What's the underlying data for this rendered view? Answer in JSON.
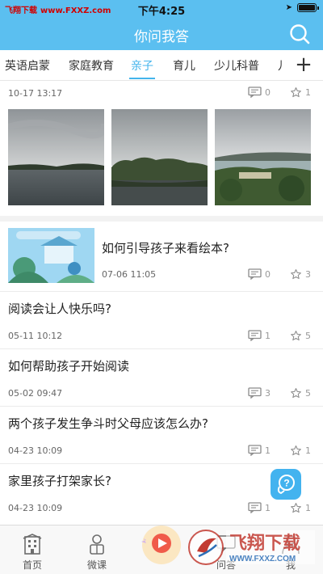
{
  "status_bar": {
    "watermark": "飞翔下载",
    "watermark_url": "www.FXXZ.com",
    "time": "下午4:25"
  },
  "nav": {
    "title": "你问我答",
    "search_icon": "search-icon"
  },
  "tabs": {
    "items": [
      "英语启蒙",
      "家庭教育",
      "亲子",
      "育儿",
      "少儿科普",
      "儿"
    ],
    "active_index": 2,
    "add_icon": "plus-icon"
  },
  "feed": {
    "photo_post": {
      "time": "10-17 13:17",
      "comments": "0",
      "likes": "1"
    },
    "thumb_post": {
      "title": "如何引导孩子来看绘本?",
      "time": "07-06 11:05",
      "comments": "0",
      "likes": "3"
    },
    "questions": [
      {
        "title": "阅读会让人快乐吗?",
        "time": "05-11 10:12",
        "comments": "1",
        "likes": "5"
      },
      {
        "title": "如何帮助孩子开始阅读",
        "time": "05-02 09:47",
        "comments": "3",
        "likes": "5"
      },
      {
        "title": "两个孩子发生争斗时父母应该怎么办?",
        "time": "04-23 10:09",
        "comments": "1",
        "likes": "1"
      },
      {
        "title": "家里孩子打架家长?",
        "time": "04-23 10:09",
        "comments": "1",
        "likes": "1"
      }
    ]
  },
  "fab": {
    "icon": "help-question-icon"
  },
  "tabbar": {
    "items": [
      {
        "label": "首页",
        "icon": "building-icon"
      },
      {
        "label": "微课",
        "icon": "person-icon"
      },
      {
        "label": "",
        "icon": "play-icon"
      },
      {
        "label": "问答",
        "icon": "chat-icon"
      },
      {
        "label": "我",
        "icon": "user-icon"
      }
    ]
  },
  "watermark_logo": {
    "text": "飞翔下载",
    "url": "WWW.FXXZ.COM"
  },
  "colors": {
    "accent": "#5bbff0",
    "active_tab": "#44b4ec",
    "fab": "#43b3ef"
  }
}
